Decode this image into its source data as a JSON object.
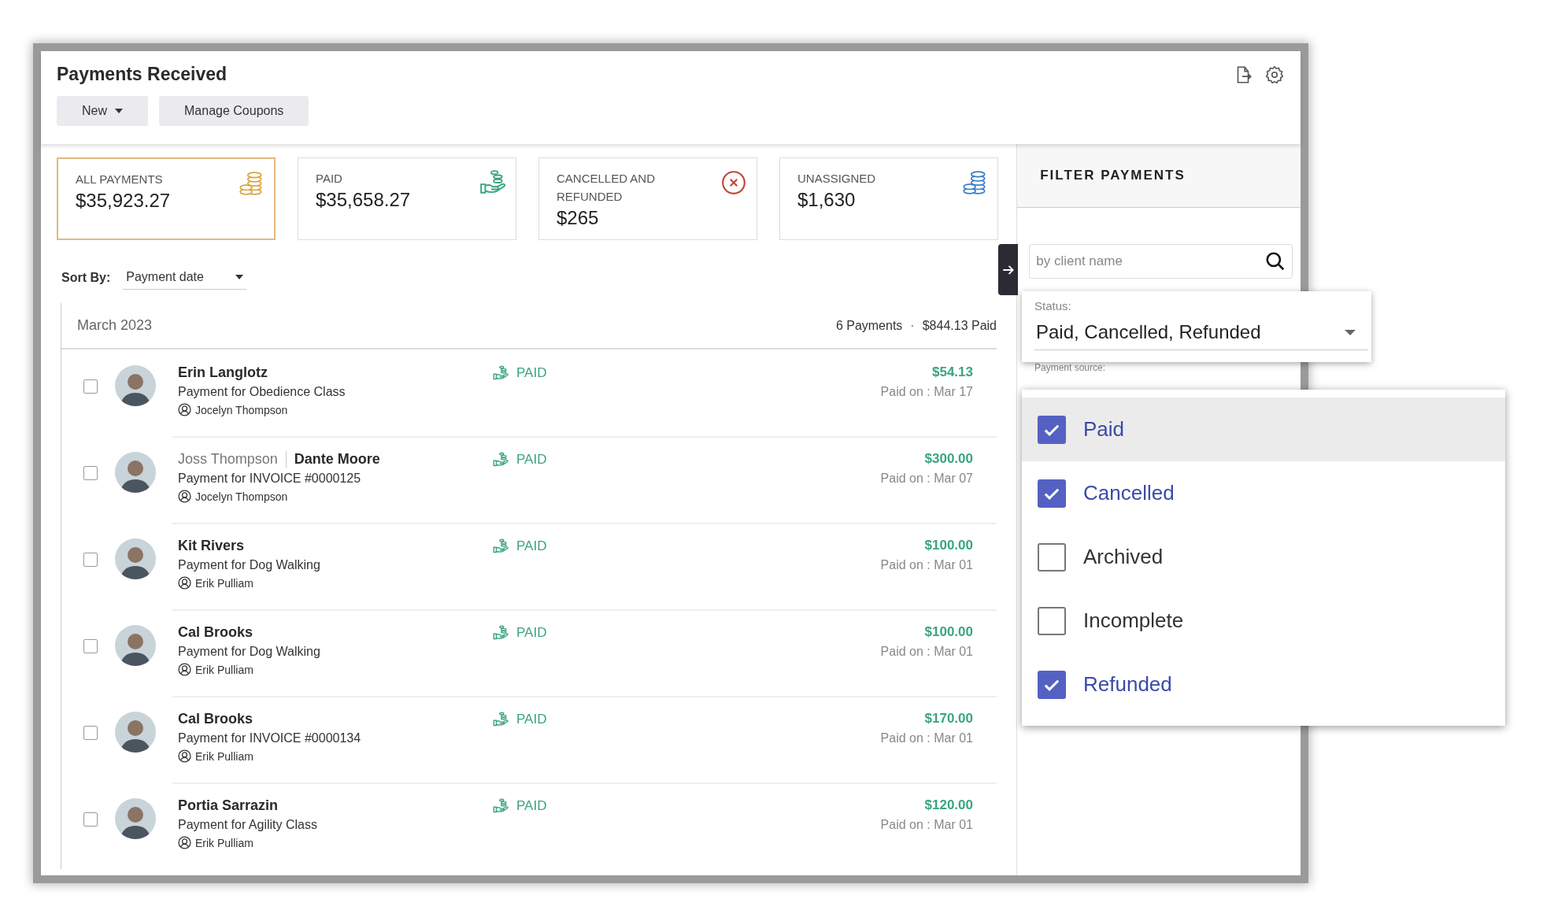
{
  "page": {
    "title": "Payments Received"
  },
  "toolbar": [
    {
      "label": "New",
      "kind": "dropdown"
    },
    {
      "label": "Manage Coupons",
      "kind": "plain"
    }
  ],
  "summary_cards": [
    {
      "label": "ALL PAYMENTS",
      "value": "$35,923.27",
      "selected": true,
      "kind": "gold-coins"
    },
    {
      "label": "PAID",
      "value": "$35,658.27",
      "selected": false,
      "kind": "hand-coins"
    },
    {
      "label": "CANCELLED AND REFUNDED",
      "value": "$265",
      "selected": false,
      "kind": "cancel"
    },
    {
      "label": "UNASSIGNED",
      "value": "$1,630",
      "selected": false,
      "kind": "blue-coins"
    }
  ],
  "sort": {
    "label": "Sort By:",
    "value": "Payment date"
  },
  "group": {
    "title": "March 2023",
    "count": "6 Payments",
    "separator": "·",
    "total": "$844.13 Paid"
  },
  "payments": [
    {
      "name": "Erin Langlotz",
      "description": "Payment for Obedience Class",
      "staff": "Jocelyn Thompson",
      "status": "PAID",
      "amount": "$54.13",
      "paid_on": "Paid on : Mar 17",
      "checked": false
    },
    {
      "linked_name": "Joss Thompson",
      "name": "Dante Moore",
      "description": "Payment for INVOICE #0000125",
      "staff": "Jocelyn Thompson",
      "status": "PAID",
      "amount": "$300.00",
      "paid_on": "Paid on : Mar 07",
      "checked": false
    },
    {
      "name": "Kit Rivers",
      "description": "Payment for Dog Walking",
      "staff": "Erik Pulliam",
      "status": "PAID",
      "amount": "$100.00",
      "paid_on": "Paid on : Mar 01",
      "checked": false
    },
    {
      "name": "Cal Brooks",
      "description": "Payment for Dog Walking",
      "staff": "Erik Pulliam",
      "status": "PAID",
      "amount": "$100.00",
      "paid_on": "Paid on : Mar 01",
      "checked": false
    },
    {
      "name": "Cal Brooks",
      "description": "Payment for INVOICE #0000134",
      "staff": "Erik Pulliam",
      "status": "PAID",
      "amount": "$170.00",
      "paid_on": "Paid on : Mar 01",
      "checked": false
    },
    {
      "name": "Portia Sarrazin",
      "description": "Payment for Agility Class",
      "staff": "Erik Pulliam",
      "status": "PAID",
      "amount": "$120.00",
      "paid_on": "Paid on : Mar 01",
      "checked": false
    }
  ],
  "filter": {
    "title": "FILTER PAYMENTS",
    "search_placeholder": "by client name",
    "status_label": "Status:",
    "status_value": "Paid, Cancelled, Refunded",
    "source_label": "Payment source:"
  },
  "status_options": [
    {
      "label": "Paid",
      "checked": true,
      "highlighted": true
    },
    {
      "label": "Cancelled",
      "checked": true,
      "highlighted": false
    },
    {
      "label": "Archived",
      "checked": false,
      "highlighted": false
    },
    {
      "label": "Incomplete",
      "checked": false,
      "highlighted": false
    },
    {
      "label": "Refunded",
      "checked": true,
      "highlighted": false
    }
  ]
}
